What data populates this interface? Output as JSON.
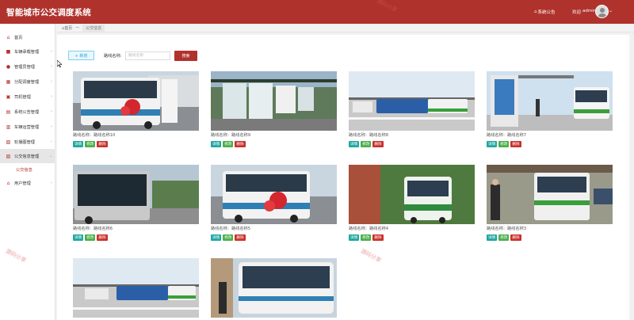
{
  "header": {
    "title": "智能城市公交调度系统",
    "announcement": "系统公告",
    "welcome": "欢迎",
    "username": "admin",
    "caret": "⌄"
  },
  "breadcrumb": {
    "home": "首页",
    "sep": "—",
    "current": "公交信息"
  },
  "sidebar": {
    "items": [
      {
        "label": "首页",
        "icon": "home-icon"
      },
      {
        "label": "车辆承载管理",
        "icon": "bus-icon"
      },
      {
        "label": "管理员管理",
        "icon": "user-icon"
      },
      {
        "label": "分配调度管理",
        "icon": "grid-icon"
      },
      {
        "label": "司机管理",
        "icon": "driver-icon"
      },
      {
        "label": "系统公告管理",
        "icon": "notice-icon"
      },
      {
        "label": "车辆运营管理",
        "icon": "operation-icon"
      },
      {
        "label": "轮播图管理",
        "icon": "image-icon"
      },
      {
        "label": "公交信息管理",
        "icon": "info-icon"
      },
      {
        "label": "用户管理",
        "icon": "users-icon"
      }
    ],
    "sub_items": [
      {
        "label": "公交信息"
      }
    ]
  },
  "toolbar": {
    "add_label": "+ 新增",
    "search_label": "路线名称:",
    "search_placeholder": "路线名称",
    "search_button": "搜索"
  },
  "cards": [
    {
      "label": "路线名称：路线名称10",
      "detail": "详情",
      "edit": "修改",
      "del": "删除"
    },
    {
      "label": "路线名称：路线名称9",
      "detail": "详情",
      "edit": "修改",
      "del": "删除"
    },
    {
      "label": "路线名称：路线名称8",
      "detail": "详情",
      "edit": "修改",
      "del": "删除"
    },
    {
      "label": "路线名称：路线名称7",
      "detail": "详情",
      "edit": "修改",
      "del": "删除"
    },
    {
      "label": "路线名称：路线名称6",
      "detail": "详情",
      "edit": "修改",
      "del": "删除"
    },
    {
      "label": "路线名称：路线名称5",
      "detail": "详情",
      "edit": "修改",
      "del": "删除"
    },
    {
      "label": "路线名称：路线名称4",
      "detail": "详情",
      "edit": "修改",
      "del": "删除"
    },
    {
      "label": "路线名称：路线名称3",
      "detail": "详情",
      "edit": "修改",
      "del": "删除"
    },
    {
      "label": "",
      "detail": "",
      "edit": "",
      "del": ""
    },
    {
      "label": "",
      "detail": "",
      "edit": "",
      "del": ""
    }
  ],
  "watermarks": [
    "源码分享",
    "源码分享",
    "源码分享"
  ],
  "colors": {
    "brand": "#b0322c",
    "detail": "#1fa7a0",
    "edit": "#4cae4c",
    "delete": "#c9302c",
    "add_button": "#e8f8ff"
  }
}
